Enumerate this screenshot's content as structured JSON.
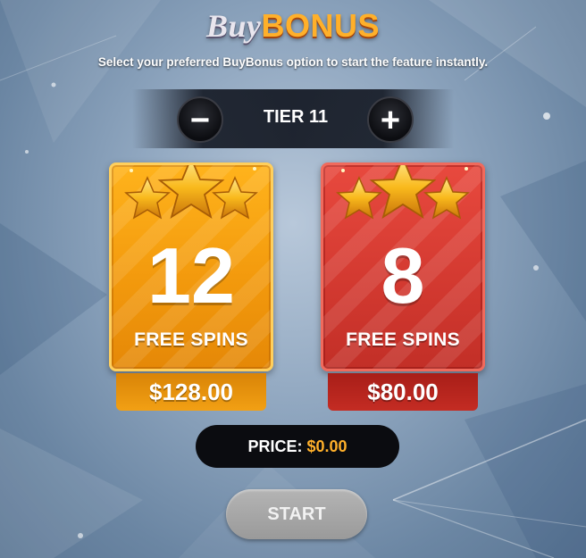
{
  "header": {
    "title_part1": "Buy",
    "title_part2": "BONUS",
    "subtitle": "Select your preferred BuyBonus option to start the feature instantly."
  },
  "tier": {
    "label": "TIER 11",
    "decrease_symbol": "−",
    "increase_symbol": "+"
  },
  "options": [
    {
      "spins": "12",
      "spins_label": "FREE SPINS",
      "price": "$128.00",
      "color": "#f39a0d"
    },
    {
      "spins": "8",
      "spins_label": "FREE SPINS",
      "price": "$80.00",
      "color": "#d43a31"
    }
  ],
  "summary": {
    "price_label": "PRICE:",
    "price_value": "$0.00"
  },
  "start_button": {
    "label": "START"
  },
  "colors": {
    "accent_gold": "#ffb02a",
    "card_gold": "#f39a0d",
    "card_red": "#d43a31",
    "start_disabled": "#a8a8a8"
  }
}
